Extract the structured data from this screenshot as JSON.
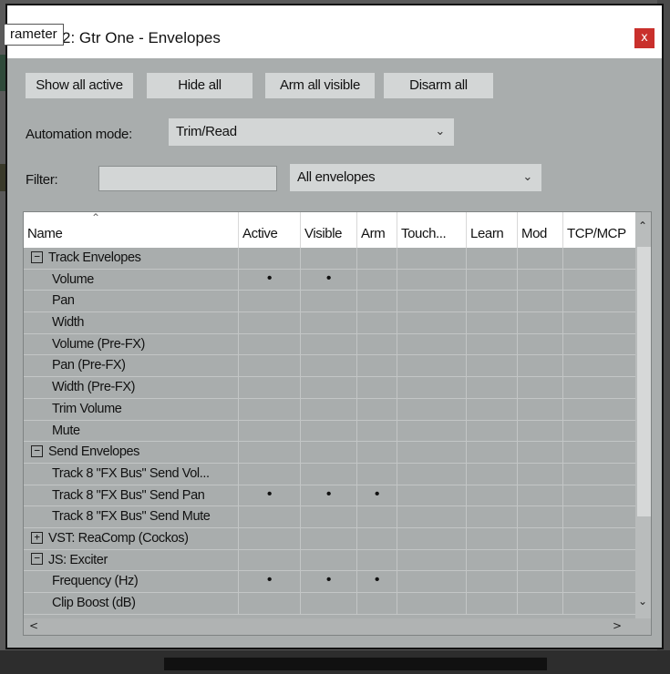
{
  "tooltip_text": "rameter",
  "window": {
    "title": "2: Gtr One - Envelopes",
    "close_label": "x"
  },
  "buttons": {
    "show_all_active": "Show all active",
    "hide_all": "Hide all",
    "arm_all_visible": "Arm all visible",
    "disarm_all": "Disarm all"
  },
  "automation": {
    "label": "Automation mode:",
    "value": "Trim/Read"
  },
  "filter": {
    "label": "Filter:",
    "value": "",
    "scope": "All envelopes"
  },
  "columns": [
    "Name",
    "Active",
    "Visible",
    "Arm",
    "Touch...",
    "Learn",
    "Mod",
    "TCP/MCP"
  ],
  "rows": [
    {
      "name": "Track Envelopes",
      "group": true,
      "expanded": true,
      "active": "",
      "visible": "",
      "arm": ""
    },
    {
      "name": "Volume",
      "active": "•",
      "visible": "•",
      "arm": ""
    },
    {
      "name": "Pan",
      "active": "",
      "visible": "",
      "arm": ""
    },
    {
      "name": "Width",
      "active": "",
      "visible": "",
      "arm": ""
    },
    {
      "name": "Volume (Pre-FX)",
      "active": "",
      "visible": "",
      "arm": ""
    },
    {
      "name": "Pan (Pre-FX)",
      "active": "",
      "visible": "",
      "arm": ""
    },
    {
      "name": "Width (Pre-FX)",
      "active": "",
      "visible": "",
      "arm": ""
    },
    {
      "name": "Trim Volume",
      "active": "",
      "visible": "",
      "arm": ""
    },
    {
      "name": "Mute",
      "active": "",
      "visible": "",
      "arm": ""
    },
    {
      "name": "Send Envelopes",
      "group": true,
      "expanded": true,
      "active": "",
      "visible": "",
      "arm": ""
    },
    {
      "name": "Track 8 \"FX Bus\" Send Vol...",
      "active": "",
      "visible": "",
      "arm": ""
    },
    {
      "name": "Track 8 \"FX Bus\" Send Pan",
      "active": "•",
      "visible": "•",
      "arm": "•"
    },
    {
      "name": "Track 8 \"FX Bus\" Send Mute",
      "active": "",
      "visible": "",
      "arm": ""
    },
    {
      "name": "VST: ReaComp (Cockos)",
      "group": true,
      "expanded": false,
      "active": "",
      "visible": "",
      "arm": ""
    },
    {
      "name": "JS: Exciter",
      "group": true,
      "expanded": true,
      "active": "",
      "visible": "",
      "arm": ""
    },
    {
      "name": "Frequency (Hz)",
      "active": "•",
      "visible": "•",
      "arm": "•"
    },
    {
      "name": "Clip Boost (dB)",
      "active": "",
      "visible": "",
      "arm": ""
    }
  ],
  "colors": {
    "panel": "#a9adad",
    "button": "#d3d6d6",
    "close": "#c9302c"
  }
}
